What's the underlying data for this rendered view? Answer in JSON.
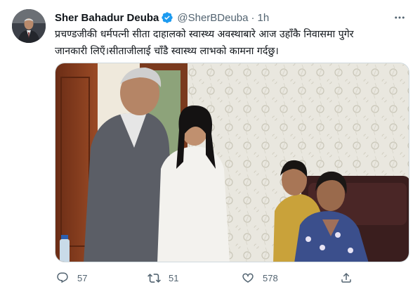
{
  "tweet": {
    "author_name": "Sher Bahadur Deuba",
    "handle": "@SherBDeuba",
    "separator": "·",
    "time": "1h",
    "text_line1": "प्रचण्डजीकी धर्मपत्नी सीता दाहालको स्वास्थ्य अवस्थाबारे आज उहाँकै निवासमा पुगेर",
    "text_line2": "जानकारी लिएँ।सीताजीलाई चाँडै स्वास्थ्य लाभको कामना गर्दछु।",
    "verified_icon": "verified-badge-icon",
    "accent_color": "#1d9bf0"
  },
  "actions": {
    "reply_count": "57",
    "retweet_count": "51",
    "like_count": "578"
  },
  "icons": {
    "reply": "reply-icon",
    "retweet": "retweet-icon",
    "like": "heart-icon",
    "share": "share-icon",
    "more": "more-icon"
  }
}
